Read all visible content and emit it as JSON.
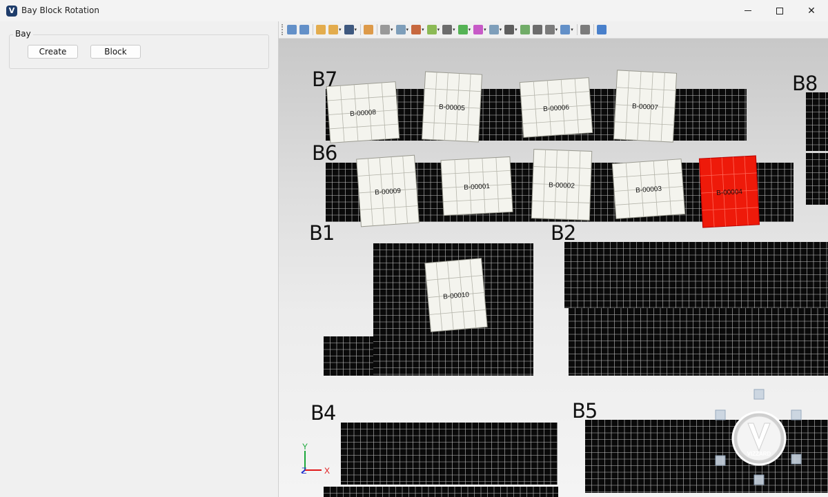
{
  "window": {
    "title": "Bay Block Rotation",
    "app_icon": "V"
  },
  "left_panel": {
    "group_label": "Bay",
    "buttons": [
      {
        "label": "Create"
      },
      {
        "label": "Block"
      }
    ]
  },
  "toolbar": {
    "icons": [
      {
        "name": "new-document-icon",
        "color": "#4a7fc1",
        "dropdown": false
      },
      {
        "name": "new-window-icon",
        "color": "#4a7fc1",
        "dropdown": false
      },
      {
        "name": "open-folder-icon",
        "color": "#e0a030",
        "dropdown": false
      },
      {
        "name": "open-recent-icon",
        "color": "#e0a030",
        "dropdown": true
      },
      {
        "name": "save-icon",
        "color": "#1f3d6b",
        "dropdown": true
      },
      {
        "name": "tree-view-icon",
        "color": "#d98b2b",
        "dropdown": false
      },
      {
        "name": "select-icon",
        "color": "#8a8a8a",
        "dropdown": true
      },
      {
        "name": "transform-icon",
        "color": "#6a8fb0",
        "dropdown": true
      },
      {
        "name": "shape-cone-icon",
        "color": "#c0501f",
        "dropdown": true
      },
      {
        "name": "check-icon",
        "color": "#7ab03a",
        "dropdown": true
      },
      {
        "name": "eye-icon",
        "color": "#555555",
        "dropdown": true
      },
      {
        "name": "rotate-icon",
        "color": "#3aa83a",
        "dropdown": true
      },
      {
        "name": "color-wheel-icon",
        "color": "#c040c0",
        "dropdown": true
      },
      {
        "name": "measure-icon",
        "color": "#6a8fb0",
        "dropdown": true
      },
      {
        "name": "binoculars-icon",
        "color": "#444444",
        "dropdown": true
      },
      {
        "name": "image-icon",
        "color": "#5aa050",
        "dropdown": false
      },
      {
        "name": "print-icon",
        "color": "#555555",
        "dropdown": false
      },
      {
        "name": "axes-icon",
        "color": "#666666",
        "dropdown": true
      },
      {
        "name": "window-layout-icon",
        "color": "#4a7fc1",
        "dropdown": true
      },
      {
        "name": "settings-gear-icon",
        "color": "#666666",
        "dropdown": false
      },
      {
        "name": "info-icon",
        "color": "#2b6cc4",
        "dropdown": false
      }
    ]
  },
  "viewport": {
    "bays": [
      {
        "label": "B7"
      },
      {
        "label": "B8"
      },
      {
        "label": "B6"
      },
      {
        "label": "B1"
      },
      {
        "label": "B2"
      },
      {
        "label": "B4"
      },
      {
        "label": "B5"
      }
    ],
    "blocks": [
      {
        "id": "B-00008",
        "selected": false
      },
      {
        "id": "B-00005",
        "selected": false
      },
      {
        "id": "B-00006",
        "selected": false
      },
      {
        "id": "B-00007",
        "selected": false
      },
      {
        "id": "B-00009",
        "selected": false
      },
      {
        "id": "B-00001",
        "selected": false
      },
      {
        "id": "B-00002",
        "selected": false
      },
      {
        "id": "B-00003",
        "selected": false
      },
      {
        "id": "B-00004",
        "selected": true
      },
      {
        "id": "B-00010",
        "selected": false
      }
    ],
    "axis": {
      "y_label": "Y",
      "z_label": "Z",
      "x_label": "X"
    },
    "logo_text": "VIZZARD",
    "colors": {
      "grid_fill": "#0a0a0a",
      "grid_line": "#ffffff",
      "block_fill": "#f4f4ee",
      "selected_block_fill": "#ee1a0a"
    }
  }
}
